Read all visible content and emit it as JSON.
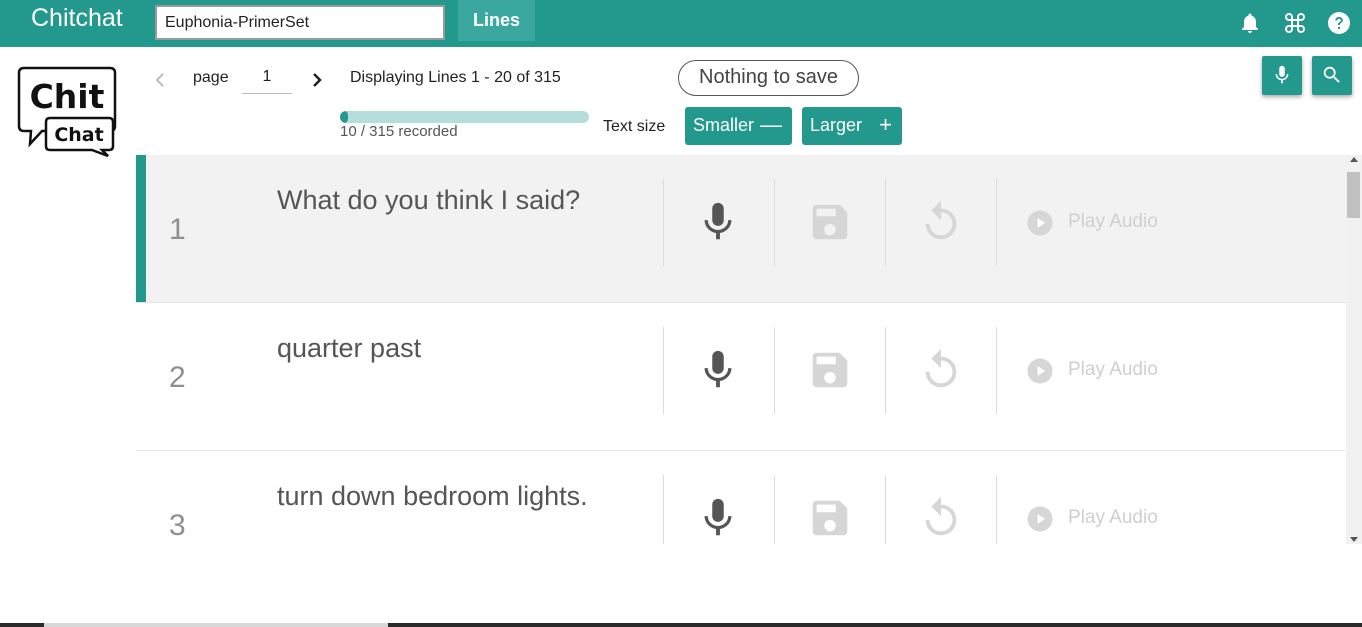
{
  "app": {
    "title": "Chitchat"
  },
  "header": {
    "set_name": "Euphonia-PrimerSet",
    "tab_label": "Lines",
    "icons": [
      "bell-icon",
      "command-icon",
      "help-icon"
    ]
  },
  "logo": {
    "line1": "Chit",
    "line2": "Chat"
  },
  "pager": {
    "page_label": "page",
    "page_value": "1",
    "display_text": "Displaying Lines 1 - 20 of 315"
  },
  "save_status": "Nothing to save",
  "progress": {
    "recorded": 10,
    "total": 315,
    "text": "10 / 315 recorded"
  },
  "text_size": {
    "label": "Text size",
    "smaller": "Smaller",
    "larger": "Larger"
  },
  "colors": {
    "accent": "#23998e",
    "progress_track": "#b5dedb"
  },
  "lines": [
    {
      "number": "1",
      "text": "What do you think I said?",
      "play_label": "Play Audio",
      "active": true
    },
    {
      "number": "2",
      "text": "quarter past",
      "play_label": "Play Audio",
      "active": false
    },
    {
      "number": "3",
      "text": "turn down bedroom lights.",
      "play_label": "Play Audio",
      "active": false
    }
  ]
}
